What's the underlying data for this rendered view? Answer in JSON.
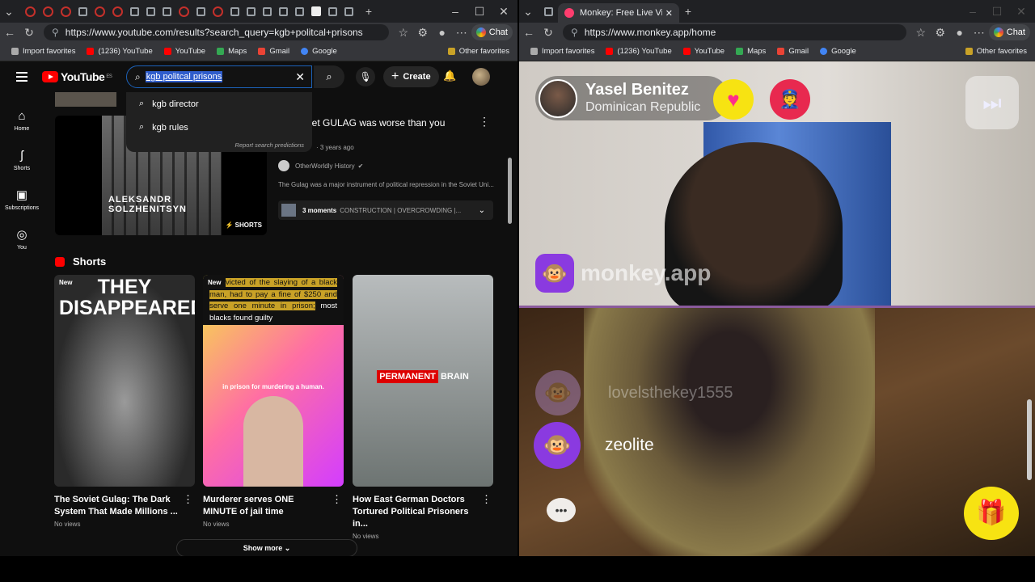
{
  "left_browser": {
    "address": "https://www.youtube.com/results?search_query=kgb+politcal+prisons",
    "chat_label": "Chat",
    "bookmarks": [
      "Import favorites",
      "(1236) YouTube",
      "YouTube",
      "Maps",
      "Gmail",
      "Google"
    ],
    "other_favorites": "Other favorites"
  },
  "youtube": {
    "logo": "YouTube",
    "logo_region": "ES",
    "search_value": "kgb politcal prisons",
    "suggestions": [
      "kgb director",
      "kgb rules"
    ],
    "report_predictions": "Report search predictions",
    "create_label": "Create",
    "sidebar": [
      "Home",
      "Shorts",
      "Subscriptions",
      "You"
    ],
    "video": {
      "title": "iet GULAG was worse than you",
      "meta": "· 3 years ago",
      "channel": "OtherWorldly History",
      "description": "The Gulag was a major instrument of political repression in the Soviet Uni...",
      "moments_count": "3 moments",
      "moments_text": "CONSTRUCTION | OVERCROWDING |...",
      "thumb_name_line1": "ALEKSANDR",
      "thumb_name_line2": "SOLZHENITSYN",
      "shorts_badge": "SHORTS"
    },
    "shorts_heading": "Shorts",
    "shorts": [
      {
        "badge": "New",
        "caption": "THEY DISAPPEARED",
        "title": "The Soviet Gulag: The Dark System That Made Millions ...",
        "views": "No views"
      },
      {
        "badge": "New",
        "caption_highlight1": "victed of the slaying of a black man, had to pay a fine of $250 and serve one minute in prison;",
        "caption_rest": "most blacks found guilty",
        "caption_mid": "in prison for murdering a human.",
        "title": "Murderer serves ONE MINUTE of jail time",
        "views": "No views"
      },
      {
        "badge": "",
        "caption_red": "PERMANENT",
        "caption_white": "BRAIN",
        "title": "How East German Doctors Tortured Political Prisoners in...",
        "views": "No views"
      }
    ],
    "show_more": "Show more"
  },
  "right_browser": {
    "tab_title": "Monkey: Free Live Video Chat",
    "address": "https://www.monkey.app/home",
    "chat_label": "Chat",
    "bookmarks": [
      "Import favorites",
      "(1236) YouTube",
      "YouTube",
      "Maps",
      "Gmail",
      "Google"
    ],
    "other_favorites": "Other favorites"
  },
  "monkey": {
    "peer_name": "Yasel Benitez",
    "peer_country": "Dominican Republic",
    "brand": "monkey.app",
    "faint_user": "lovelsthekey1555",
    "user": "zeolite"
  }
}
